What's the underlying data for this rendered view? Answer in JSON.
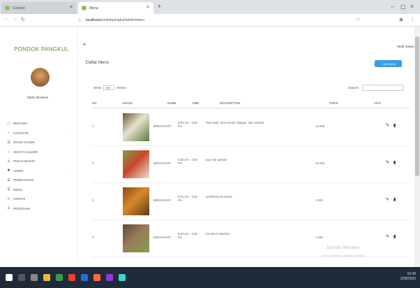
{
  "browser": {
    "tab1": "Contact",
    "tab2": "Menu",
    "new_tab": "+",
    "url_host": "localhost",
    "url_path": "/pondokpangkul/admin/menu"
  },
  "app": {
    "logo": "PONDOK PANGKUL",
    "user_name": "MEDI IRAWAN",
    "top_user": "Medi Irawan"
  },
  "sidebar": [
    {
      "icon": "chat-icon",
      "label": "BERANDA",
      "chev": false
    },
    {
      "icon": "tag-icon",
      "label": "KATEGORI",
      "chev": true
    },
    {
      "icon": "list-icon",
      "label": "IMAGE SLIDER",
      "chev": false
    },
    {
      "icon": "tag-icon",
      "label": "WISATA KULINER",
      "chev": false
    },
    {
      "icon": "user-icon",
      "label": "PESAN MASUK",
      "chev": false
    },
    {
      "icon": "gear-icon",
      "label": "ADMIN",
      "chev": true
    },
    {
      "icon": "list-icon",
      "label": "PEMBAYARAN",
      "chev": false
    },
    {
      "icon": "list-icon",
      "label": "MENU",
      "chev": false
    },
    {
      "icon": "pencil-icon",
      "label": "KONTAK",
      "chev": false
    },
    {
      "icon": "user-icon",
      "label": "PENGGUNA",
      "chev": false
    }
  ],
  "page": {
    "title": "Daftar Menu",
    "add_button": "+ Add Menu",
    "show": "Show",
    "entries_value": "10",
    "entries": "entries",
    "search_label": "Search:"
  },
  "table": {
    "columns": [
      "NO",
      "IMAGE",
      "NAME",
      "TIME",
      "DESCRIPTION",
      "PRICE",
      "AKSI"
    ],
    "rows": [
      {
        "no": "1",
        "name": "BREAKFAST",
        "time": "8:00 Am - 2:00 Pm",
        "desc": "Nasi liwet, tahu tempe, lalapan, dan sambal",
        "price": "12.000",
        "img_colors": [
          "#6a5a3a",
          "#e7e1cf",
          "#5a7b3a"
        ]
      },
      {
        "no": "2",
        "name": "BREAKFAST",
        "time": "8:00 Am - 2:00 Pm",
        "desc": "pop mie spesial",
        "price": "10.000",
        "img_colors": [
          "#7aa34a",
          "#c8462a",
          "#e8e0d0"
        ]
      },
      {
        "no": "3",
        "name": "BREAKFAST",
        "time": "8:00 Am - 2:00 Pm",
        "desc": "GORENGAN ENAK",
        "price": "1.000",
        "img_colors": [
          "#8a4a1a",
          "#d88a2a",
          "#5a3a1a"
        ]
      },
      {
        "no": "4",
        "name": "BREAKFAST",
        "time": "8:00 Am - 2:00 Pm",
        "desc": "ES MILO DINGIN",
        "price": "7.000",
        "img_colors": [
          "#5a4a3a",
          "#9a7a5a",
          "#7aa34a"
        ]
      }
    ]
  },
  "watermark": {
    "line1": "Activate Windows",
    "line2": "Go to Settings to activate Windows."
  },
  "tray": {
    "time": "10:49",
    "date": "2/08/2020"
  }
}
